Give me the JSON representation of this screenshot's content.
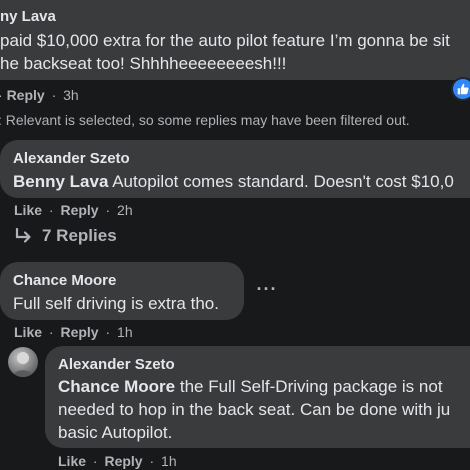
{
  "comment1": {
    "author": "ny Lava",
    "line1": "paid $10,000 extra for the auto pilot feature I’m gonna be sit",
    "line2": "he backseat too! Shhhheeeeeeeesh!!!",
    "reply_label": "Reply",
    "time": "3h",
    "reaction_icon": "like-thumb-icon"
  },
  "filter_note": ": Relevant is selected, so some replies may have been filtered out.",
  "comment2": {
    "author": "Alexander Szeto",
    "mention": "Benny Lava",
    "text": " Autopilot comes standard. Doesn't cost $10,0",
    "like_label": "Like",
    "reply_label": "Reply",
    "time": "2h"
  },
  "replies_link": {
    "label": "7 Replies",
    "icon": "reply-arrow-icon"
  },
  "comment3": {
    "author": "Chance Moore",
    "text": "Full self driving is extra tho.",
    "like_label": "Like",
    "reply_label": "Reply",
    "time": "1h",
    "more_icon": "more-options-icon"
  },
  "comment4": {
    "author": "Alexander Szeto",
    "mention": "Chance Moore",
    "line1": " the Full Self-Driving package is not",
    "line2": "needed to hop in the back seat. Can be done with ju",
    "line3": "basic Autopilot.",
    "like_label": "Like",
    "reply_label": "Reply",
    "time": "1h",
    "avatar_icon": "user-avatar"
  },
  "colors": {
    "background": "#18191a",
    "bubble": "#3a3b3c",
    "text": "#e4e6eb",
    "secondary": "#b0b3b8",
    "like_blue": "#2d88ff"
  }
}
